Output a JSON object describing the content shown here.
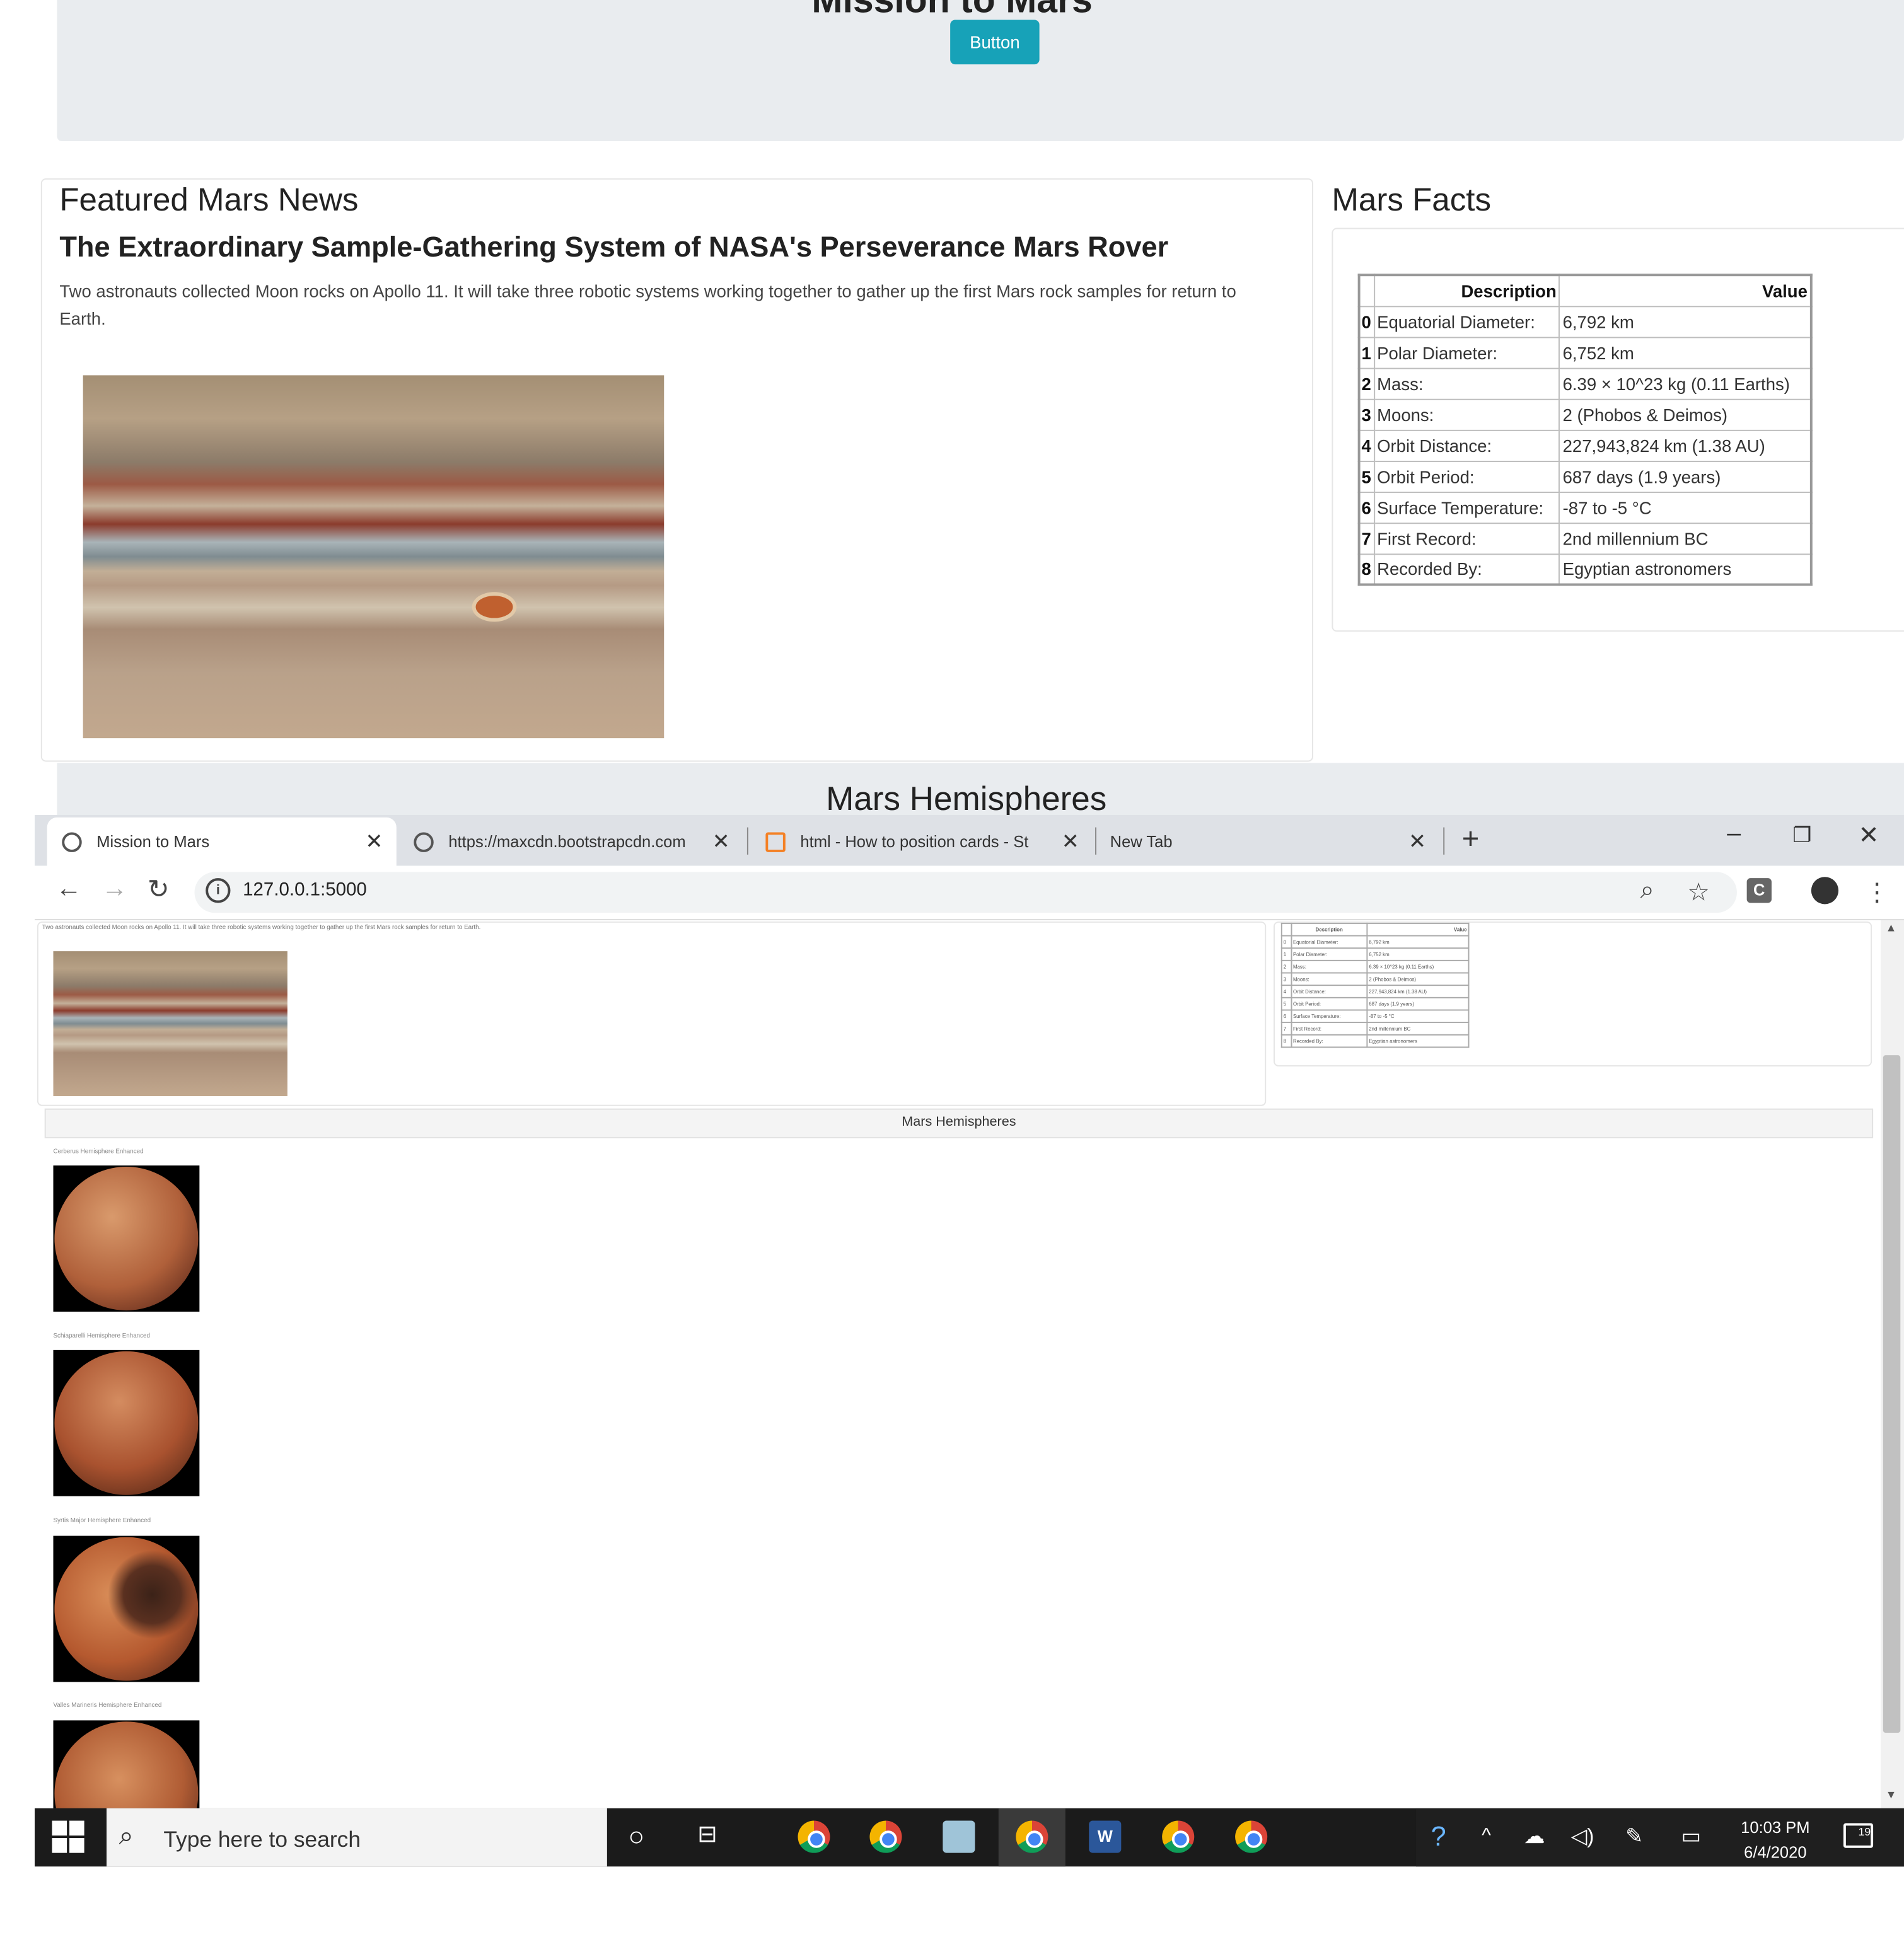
{
  "page": {
    "jumbotron_title": "Mission to Mars",
    "button_label": "Button"
  },
  "news": {
    "heading": "Featured Mars News",
    "title": "The Extraordinary Sample-Gathering System of NASA's Perseverance Mars Rover",
    "paragraph": "Two astronauts collected Moon rocks on Apollo 11. It will take three robotic systems working together to gather up the first Mars rock samples for return to Earth."
  },
  "facts": {
    "heading": "Mars Facts",
    "columns": [
      "Description",
      "Value"
    ],
    "rows": [
      {
        "idx": "0",
        "desc": "Equatorial Diameter:",
        "val": "6,792 km"
      },
      {
        "idx": "1",
        "desc": "Polar Diameter:",
        "val": "6,752 km"
      },
      {
        "idx": "2",
        "desc": "Mass:",
        "val": "6.39 × 10^23 kg (0.11 Earths)"
      },
      {
        "idx": "3",
        "desc": "Moons:",
        "val": "2 (Phobos & Deimos)"
      },
      {
        "idx": "4",
        "desc": "Orbit Distance:",
        "val": "227,943,824 km (1.38 AU)"
      },
      {
        "idx": "5",
        "desc": "Orbit Period:",
        "val": "687 days (1.9 years)"
      },
      {
        "idx": "6",
        "desc": "Surface Temperature:",
        "val": "-87 to -5 °C"
      },
      {
        "idx": "7",
        "desc": "First Record:",
        "val": "2nd millennium BC"
      },
      {
        "idx": "8",
        "desc": "Recorded By:",
        "val": "Egyptian astronomers"
      }
    ]
  },
  "hemispheres": {
    "heading": "Mars Hemispheres",
    "items": [
      {
        "caption": "Cerberus Hemisphere Enhanced"
      },
      {
        "caption": "Schiaparelli Hemisphere Enhanced"
      },
      {
        "caption": "Syrtis Major Hemisphere Enhanced"
      },
      {
        "caption": "Valles Marineris Hemisphere Enhanced"
      }
    ]
  },
  "browser": {
    "tabs": [
      {
        "title": "Mission to Mars",
        "icon": "globe-icon"
      },
      {
        "title": "https://maxcdn.bootstrapcdn.com",
        "icon": "globe-icon"
      },
      {
        "title": "html - How to position cards - St",
        "icon": "stackoverflow-icon"
      },
      {
        "title": "New Tab",
        "icon": ""
      }
    ],
    "url": "127.0.0.1:5000"
  },
  "taskbar": {
    "search_placeholder": "Type here to search",
    "time": "10:03 PM",
    "date": "6/4/2020",
    "notification_count": "19"
  },
  "colors": {
    "jumbotron_bg": "#e9ecef",
    "button_bg": "#17a2b8",
    "tabbar_bg": "#dee1e6",
    "taskbar_bg": "#1b1b1b"
  }
}
